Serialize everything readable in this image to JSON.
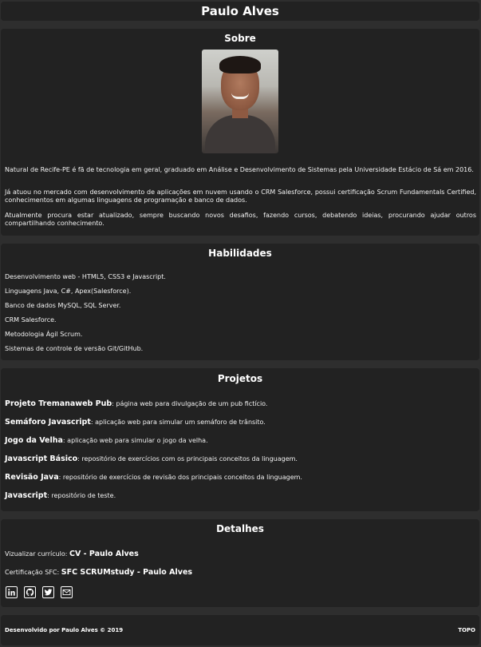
{
  "header": {
    "title": "Paulo Alves"
  },
  "sobre": {
    "title": "Sobre",
    "paragraphs": [
      "Natural de Recife-PE é fã de tecnologia em geral, graduado em Análise e Desenvolvimento de Sistemas pela Universidade Estácio de Sá em 2016.",
      "Já atuou no mercado com desenvolvimento de aplicações em nuvem usando o CRM Salesforce, possui certificação Scrum Fundamentals Certified, conhecimentos em algumas linguagens de programação e banco de dados.",
      "Atualmente procura estar atualizado, sempre buscando novos desafios, fazendo cursos, debatendo ideias, procurando ajudar outros compartilhando conhecimento."
    ]
  },
  "habilidades": {
    "title": "Habilidades",
    "items": [
      "Desenvolvimento web - HTML5, CSS3 e Javascript.",
      "Linguagens Java, C#, Apex(Salesforce).",
      "Banco de dados MySQL, SQL Server.",
      "CRM Salesforce.",
      "Metodologia Ágil Scrum.",
      "Sistemas de controle de versão Git/GitHub."
    ]
  },
  "projetos": {
    "title": "Projetos",
    "items": [
      {
        "name": "Projeto Tremanaweb Pub",
        "desc": ": página web para divulgação de um pub fictício."
      },
      {
        "name": "Semáforo Javascript",
        "desc": ": aplicação web para simular um semáforo de trânsito."
      },
      {
        "name": "Jogo da Velha",
        "desc": ": aplicação web para simular o jogo da velha."
      },
      {
        "name": "Javascript Básico",
        "desc": ": repositório de exercícios com os principais conceitos da linguagem."
      },
      {
        "name": "Revisão Java",
        "desc": ": repositório de exercícios de revisão dos principais conceitos da linguagem."
      },
      {
        "name": "Javascript",
        "desc": ": repositório de teste."
      }
    ]
  },
  "detalhes": {
    "title": "Detalhes",
    "cv_label": "Vizualizar currículo: ",
    "cv_link": "CV - Paulo Alves",
    "cert_label": "Certificação SFC: ",
    "cert_link": "SFC SCRUMstudy - Paulo Alves",
    "icons": [
      "linkedin-icon",
      "github-icon",
      "twitter-icon",
      "email-icon"
    ]
  },
  "footer": {
    "credit": "Desenvolvido por Paulo Alves © 2019",
    "top_link": "TOPO"
  }
}
